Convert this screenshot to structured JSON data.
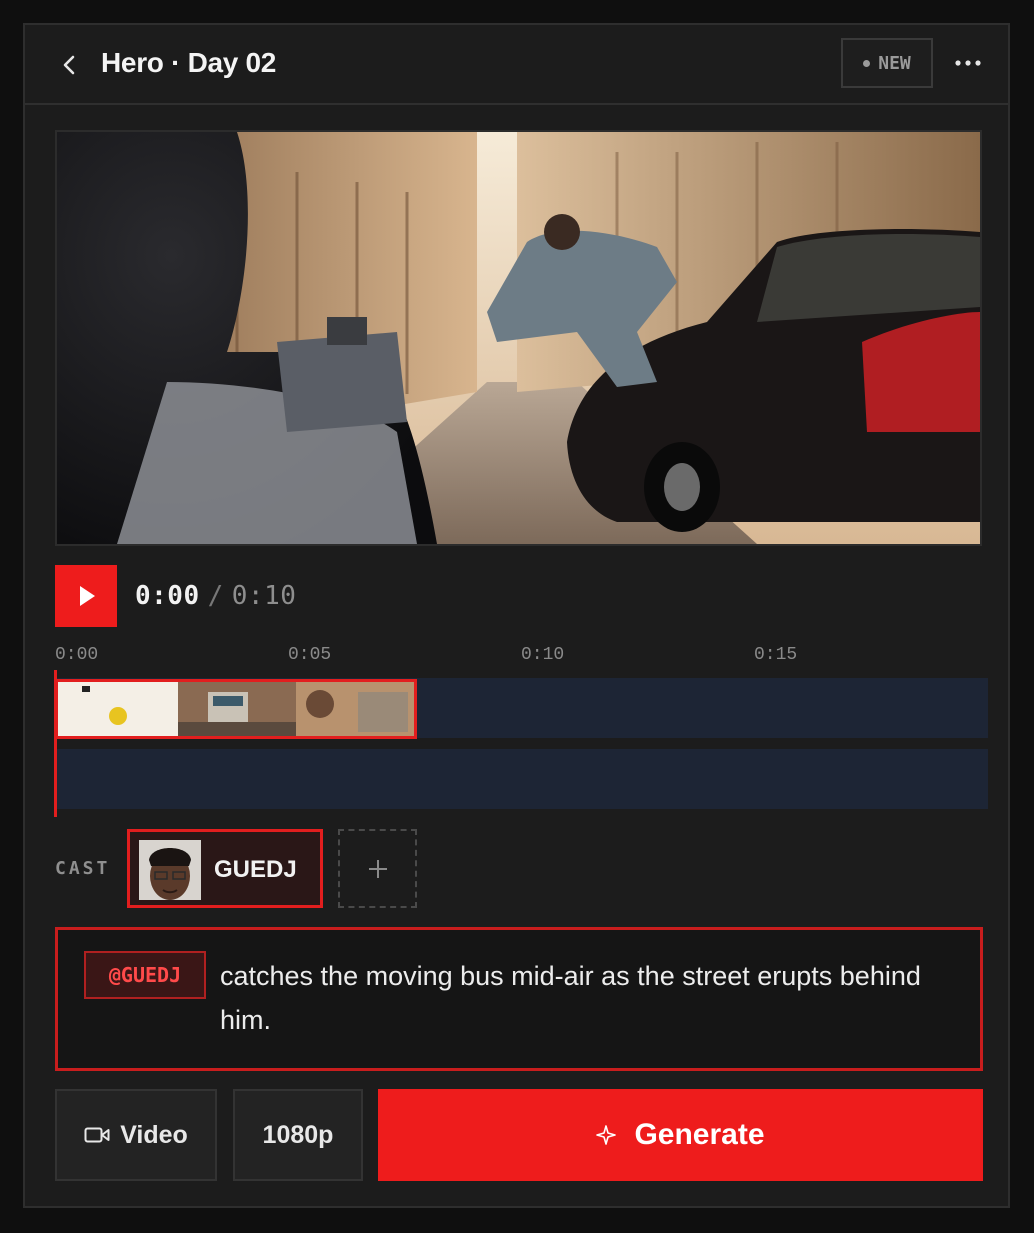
{
  "header": {
    "title": "Hero · Day 02",
    "badge": "NEW"
  },
  "player": {
    "current_time": "0:00",
    "separator": "/",
    "total_time": "0:10"
  },
  "timeline": {
    "ticks": [
      "0:00",
      "0:05",
      "0:10",
      "0:15"
    ]
  },
  "cast": {
    "label": "CAST",
    "members": [
      {
        "name": "GUEDJ"
      }
    ]
  },
  "prompt": {
    "mention": "@GUEDJ",
    "text": "catches the moving bus mid-air as the street erupts behind him."
  },
  "controls": {
    "mode_label": "Video",
    "resolution": "1080p",
    "generate_label": "Generate"
  },
  "colors": {
    "accent": "#ee1c1c",
    "panel": "#1c1c1c",
    "track": "#1d2535"
  }
}
